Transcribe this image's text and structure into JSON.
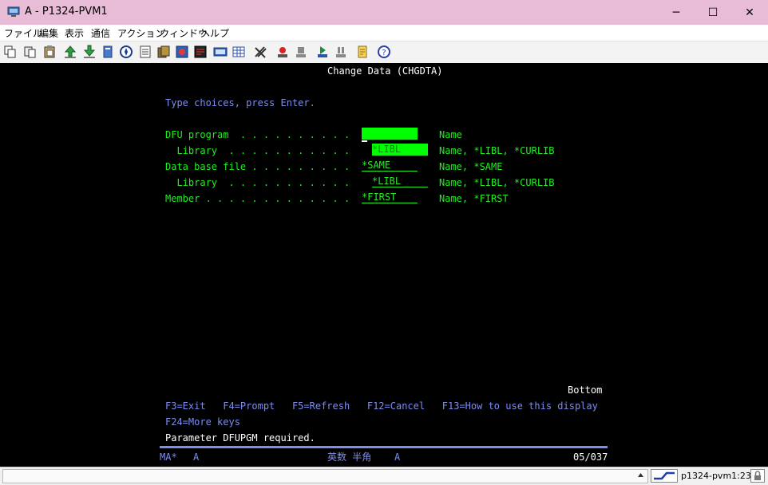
{
  "window": {
    "title": "A - P1324-PVM1",
    "minimize_glyph": "─",
    "maximize_glyph": "☐",
    "close_glyph": "✕"
  },
  "menu": [
    "ファイル",
    "編集",
    "表示",
    "通信",
    "アクション",
    "ウィンドウ",
    "ヘルプ"
  ],
  "toolbar_icons": [
    "copy-icon",
    "paste-icon",
    "clipboard-icon",
    "upload-icon",
    "download-icon",
    "document-icon",
    "navigator-icon",
    "notes-icon",
    "macro-play-icon",
    "macro-record-icon",
    "display-icon",
    "keypad-icon",
    "grid-icon",
    "tools-icon",
    "record-icon",
    "stop-icon",
    "run-icon",
    "pause-icon",
    "edit-icon",
    "help-icon"
  ],
  "screen": {
    "title": "Change Data (CHGDTA)",
    "instruction": "Type choices, press Enter.",
    "rows": [
      {
        "label": "DFU program  . . . . . . . . . .",
        "value": "",
        "hint": "Name"
      },
      {
        "label": "  Library  . . . . . . . . . . .",
        "value": "*LIBL",
        "hint": "Name, *LIBL, *CURLIB"
      },
      {
        "label": "Data base file . . . . . . . . .",
        "value": "*SAME",
        "hint": "Name, *SAME"
      },
      {
        "label": "  Library  . . . . . . . . . . .",
        "value": "*LIBL",
        "hint": "Name, *LIBL, *CURLIB"
      },
      {
        "label": "Member . . . . . . . . . . . . .",
        "value": "*FIRST",
        "hint": "Name, *FIRST"
      }
    ],
    "bottom_label": "Bottom",
    "function_keys_line1": "F3=Exit   F4=Prompt   F5=Refresh   F12=Cancel   F13=How to use this display",
    "function_keys_line2": "F24=More keys",
    "message": "Parameter DFUPGM required."
  },
  "oia": {
    "mode": "MA*",
    "session": "A",
    "ime": "英数 半角",
    "ime_session": "A",
    "cursor_position": "05/037"
  },
  "statusbar": {
    "session_name": "p1324-pvm1:23"
  }
}
